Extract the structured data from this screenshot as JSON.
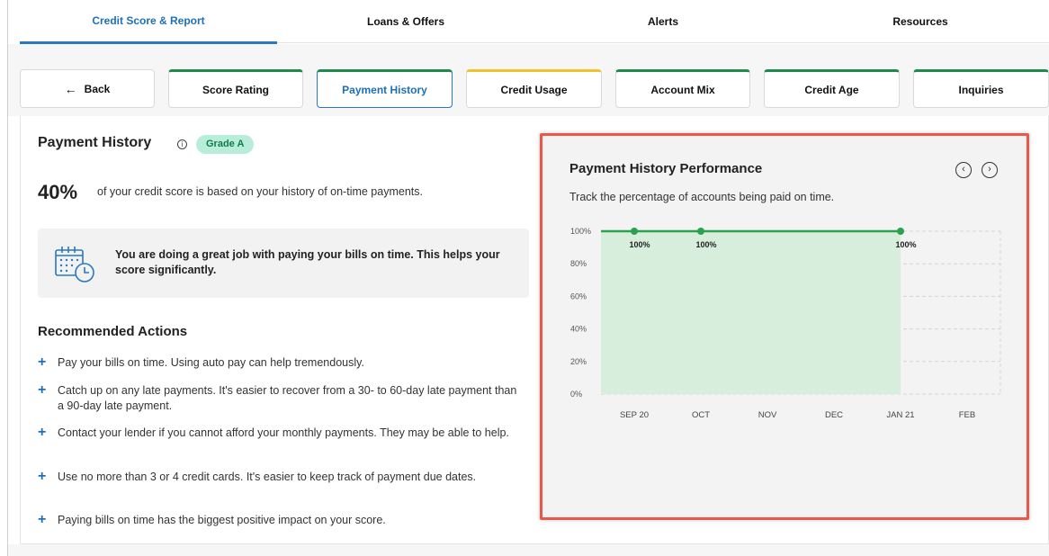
{
  "top_tabs": [
    {
      "label": "Credit Score & Report",
      "active": true
    },
    {
      "label": "Loans & Offers",
      "active": false
    },
    {
      "label": "Alerts",
      "active": false
    },
    {
      "label": "Resources",
      "active": false
    }
  ],
  "sub_tabs": [
    {
      "label": "Back",
      "icon": "back-arrow-icon"
    },
    {
      "label": "Score Rating",
      "accent": "#1f8a4c"
    },
    {
      "label": "Payment History",
      "accent": "#1f8a4c",
      "active": true
    },
    {
      "label": "Credit Usage",
      "accent": "#f2c12e"
    },
    {
      "label": "Account Mix",
      "accent": "#1f8a4c"
    },
    {
      "label": "Credit Age",
      "accent": "#1f8a4c"
    },
    {
      "label": "Inquiries",
      "accent": "#1f8a4c"
    }
  ],
  "payment_history": {
    "title": "Payment History",
    "info_icon": "info-icon",
    "grade": "Grade A",
    "percent": "40%",
    "percent_text": "of your credit score is based on your history of on-time payments.",
    "tip": "You are doing a great job with paying your bills on time. This helps your score significantly.",
    "tip_icon": "calendar-clock-icon"
  },
  "recommended": {
    "title": "Recommended Actions",
    "items": [
      "Pay your bills on time. Using auto pay can help tremendously.",
      "Catch up on any late payments. It's easier to recover from a 30- to 60-day late payment than a 90-day late payment.",
      "Contact your lender if you cannot afford your monthly payments. They may be able to help.",
      "Use no more than 3 or 4 credit cards. It's easier to keep track of payment due dates.",
      "Paying bills on time has the biggest positive impact on your score."
    ]
  },
  "chart_panel": {
    "title": "Payment History Performance",
    "subtitle": "Track the percentage of accounts being paid on time.",
    "prev_icon": "chevron-left-icon",
    "next_icon": "chevron-right-icon",
    "highlight_color": "#e8584a"
  },
  "chart_data": {
    "type": "area",
    "categories": [
      "SEP 20",
      "OCT",
      "NOV",
      "DEC",
      "JAN 21",
      "FEB"
    ],
    "y_ticks": [
      "0%",
      "20%",
      "40%",
      "60%",
      "80%",
      "100%"
    ],
    "ylim": [
      0,
      100
    ],
    "points": [
      {
        "category": "SEP 20",
        "value": 100,
        "label": "100%"
      },
      {
        "category": "OCT",
        "value": 100,
        "label": "100%"
      },
      {
        "category": "JAN 21",
        "value": 100,
        "label": "100%"
      }
    ],
    "line_color": "#2ca24f",
    "fill_color": "#d8eedd",
    "grid": true
  }
}
